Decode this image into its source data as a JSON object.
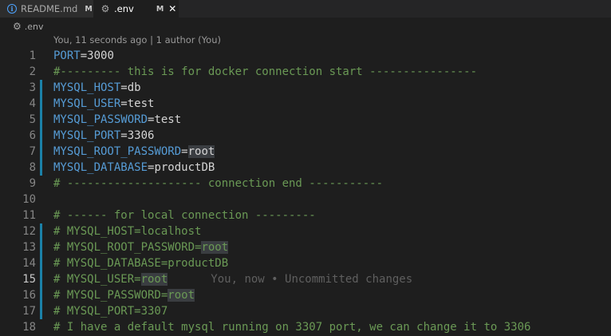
{
  "tabs": [
    {
      "name": "README.md",
      "status": "M",
      "icon": "info-icon",
      "active": false
    },
    {
      "name": ".env",
      "status": "M",
      "icon": "gear-icon",
      "active": true
    }
  ],
  "breadcrumb": {
    "file": ".env",
    "icon": "gear-icon"
  },
  "codelens": "You, 11 seconds ago | 1 author (You)",
  "blame": "You, now • Uncommitted changes",
  "current_line": 15,
  "colors": {
    "key": "#569cd6",
    "comment": "#6a9955",
    "value": "#d4d4d4",
    "modified_gutter": "#1b81a8",
    "background": "#1e1e1e"
  },
  "lines": [
    {
      "n": "1",
      "key": "PORT",
      "eq": "=",
      "val": "3000"
    },
    {
      "n": "2",
      "comment": "#--------- this is for docker connection start ----------------"
    },
    {
      "n": "3",
      "key": "MYSQL_HOST",
      "eq": "=",
      "val": "db"
    },
    {
      "n": "4",
      "key": "MYSQL_USER",
      "eq": "=",
      "val": "test"
    },
    {
      "n": "5",
      "key": "MYSQL_PASSWORD",
      "eq": "=",
      "val": "test"
    },
    {
      "n": "6",
      "key": "MYSQL_PORT",
      "eq": "=",
      "val": "3306"
    },
    {
      "n": "7",
      "key": "MYSQL_ROOT_PASSWORD",
      "eq": "=",
      "val": "root"
    },
    {
      "n": "8",
      "key": "MYSQL_DATABASE",
      "eq": "=",
      "val": "productDB"
    },
    {
      "n": "9",
      "comment": "# -------------------- connection end -----------"
    },
    {
      "n": "10"
    },
    {
      "n": "11",
      "comment": "# ------ for local connection ---------"
    },
    {
      "n": "12",
      "comment": "# MYSQL_HOST=localhost"
    },
    {
      "n": "13",
      "comment": "# MYSQL_ROOT_PASSWORD=",
      "hl": "root"
    },
    {
      "n": "14",
      "comment": "# MYSQL_DATABASE=productDB"
    },
    {
      "n": "15",
      "comment": "# MYSQL_USER=",
      "hl": "root"
    },
    {
      "n": "16",
      "comment": "# MYSQL_PASSWORD=",
      "hl": "root"
    },
    {
      "n": "17",
      "comment": "# MYSQL_PORT=3307"
    },
    {
      "n": "18",
      "comment": "# I have a default mysql running on 3307 port, we can change it to 3306"
    }
  ]
}
